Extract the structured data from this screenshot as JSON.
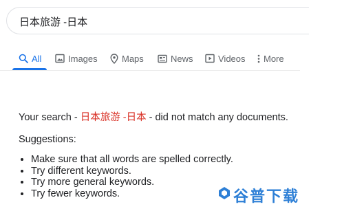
{
  "search": {
    "query": "日本旅游 -日本"
  },
  "tabs": [
    {
      "label": "All",
      "icon": "search-icon",
      "active": true
    },
    {
      "label": "Images",
      "icon": "image-icon"
    },
    {
      "label": "Maps",
      "icon": "map-pin-icon"
    },
    {
      "label": "News",
      "icon": "news-icon"
    },
    {
      "label": "Videos",
      "icon": "video-icon"
    },
    {
      "label": "More",
      "icon": "more-vert-icon"
    }
  ],
  "result": {
    "prefix": "Your search - ",
    "term": "日本旅游 -日本",
    "suffix": " - did not match any documents.",
    "suggestions_title": "Suggestions:",
    "suggestions": [
      "Make sure that all words are spelled correctly.",
      "Try different keywords.",
      "Try more general keywords.",
      "Try fewer keywords."
    ]
  },
  "watermark": {
    "text": "谷普下载"
  },
  "colors": {
    "accent": "#1a73e8",
    "highlight": "#d93025",
    "watermark": "#2d7fd6"
  }
}
